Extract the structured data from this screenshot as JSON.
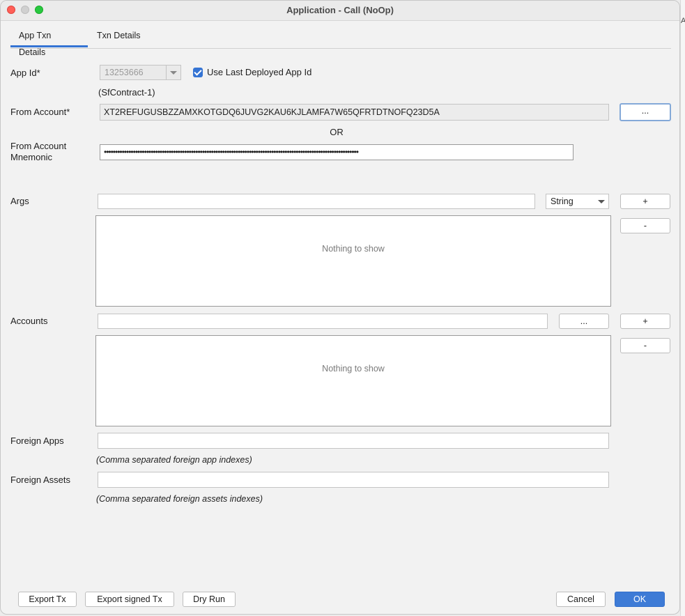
{
  "window": {
    "title": "Application - Call (NoOp)"
  },
  "tabs": [
    {
      "label": "App Txn Details",
      "active": true
    },
    {
      "label": "Txn Details",
      "active": false
    }
  ],
  "form": {
    "app_id": {
      "label": "App Id*",
      "value": "13253666",
      "use_last_label": "Use Last Deployed App Id",
      "use_last_checked": true,
      "contract_name": "(SfContract-1)"
    },
    "from_account": {
      "label": "From Account*",
      "value": "XT2REFUGUSBZZAMXKOTGDQ6JUVG2KAU6KJLAMFA7W65QFRTDTNOFQ23D5A",
      "browse_label": "..."
    },
    "or_label": "OR",
    "mnemonic": {
      "label_line1": "From Account",
      "label_line2": "Mnemonic",
      "masked_value": "••••••••••••••••••••••••••••••••••••••••••••••••••••••••••••••••••••••••••••••••••••••••••••••••••••••••••••••••••"
    },
    "args": {
      "label": "Args",
      "input_value": "",
      "type_selected": "String",
      "add_label": "+",
      "remove_label": "-",
      "empty_text": "Nothing to show"
    },
    "accounts": {
      "label": "Accounts",
      "input_value": "",
      "browse_label": "...",
      "add_label": "+",
      "remove_label": "-",
      "empty_text": "Nothing to show"
    },
    "foreign_apps": {
      "label": "Foreign Apps",
      "value": "",
      "hint": "(Comma separated foreign app indexes)"
    },
    "foreign_assets": {
      "label": "Foreign Assets",
      "value": "",
      "hint": "(Comma separated foreign assets indexes)"
    }
  },
  "footer": {
    "export_tx": "Export Tx",
    "export_signed_tx": "Export signed Tx",
    "dry_run": "Dry Run",
    "cancel": "Cancel",
    "ok": "OK"
  },
  "colors": {
    "accent": "#3574d4",
    "primary_button": "#3e7bd6",
    "close": "#ff5f57",
    "maximize": "#28c840"
  }
}
